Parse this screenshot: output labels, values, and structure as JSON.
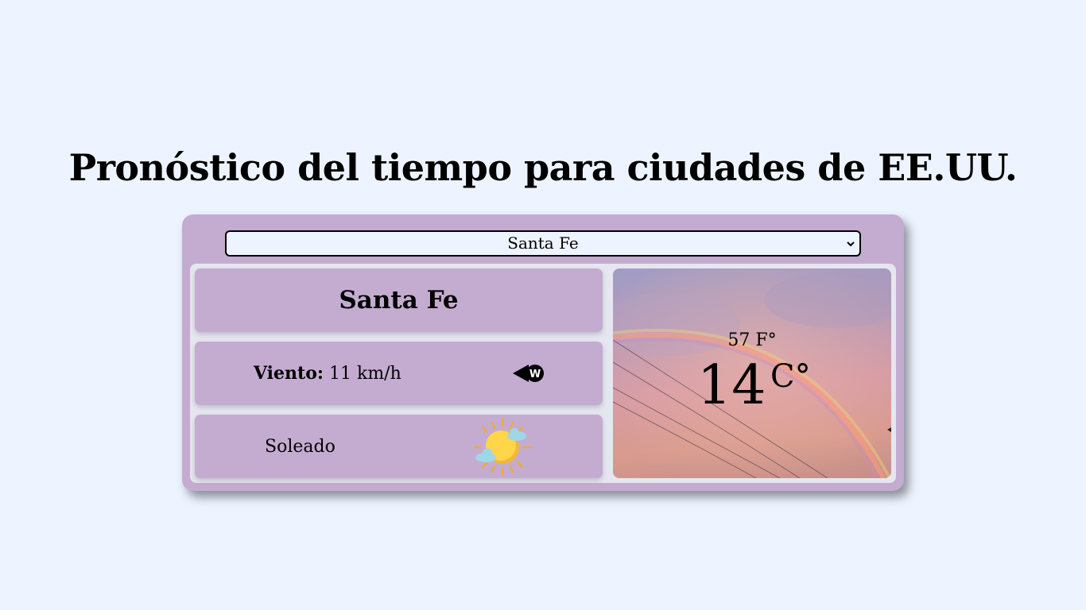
{
  "page": {
    "title": "Pronóstico del tiempo para ciudades de EE.UU."
  },
  "city_select": {
    "selected": "Santa Fe"
  },
  "weather": {
    "city": "Santa Fe",
    "wind_label": "Viento:",
    "wind_value": "11 km/h",
    "wind_direction_letter": "W",
    "condition": "Soleado",
    "temp_f": "57 F°",
    "temp_c": "14",
    "temp_c_unit": "C°"
  },
  "icons": {
    "select_arrow": "chevron-down-icon",
    "wind": "wind-direction-icon",
    "condition": "partly-sunny-icon",
    "photo": "rainbow-sky-photo"
  },
  "colors": {
    "background": "#eef4ff",
    "card": "#c4acd0",
    "inner_panel": "#e6e6f0"
  }
}
